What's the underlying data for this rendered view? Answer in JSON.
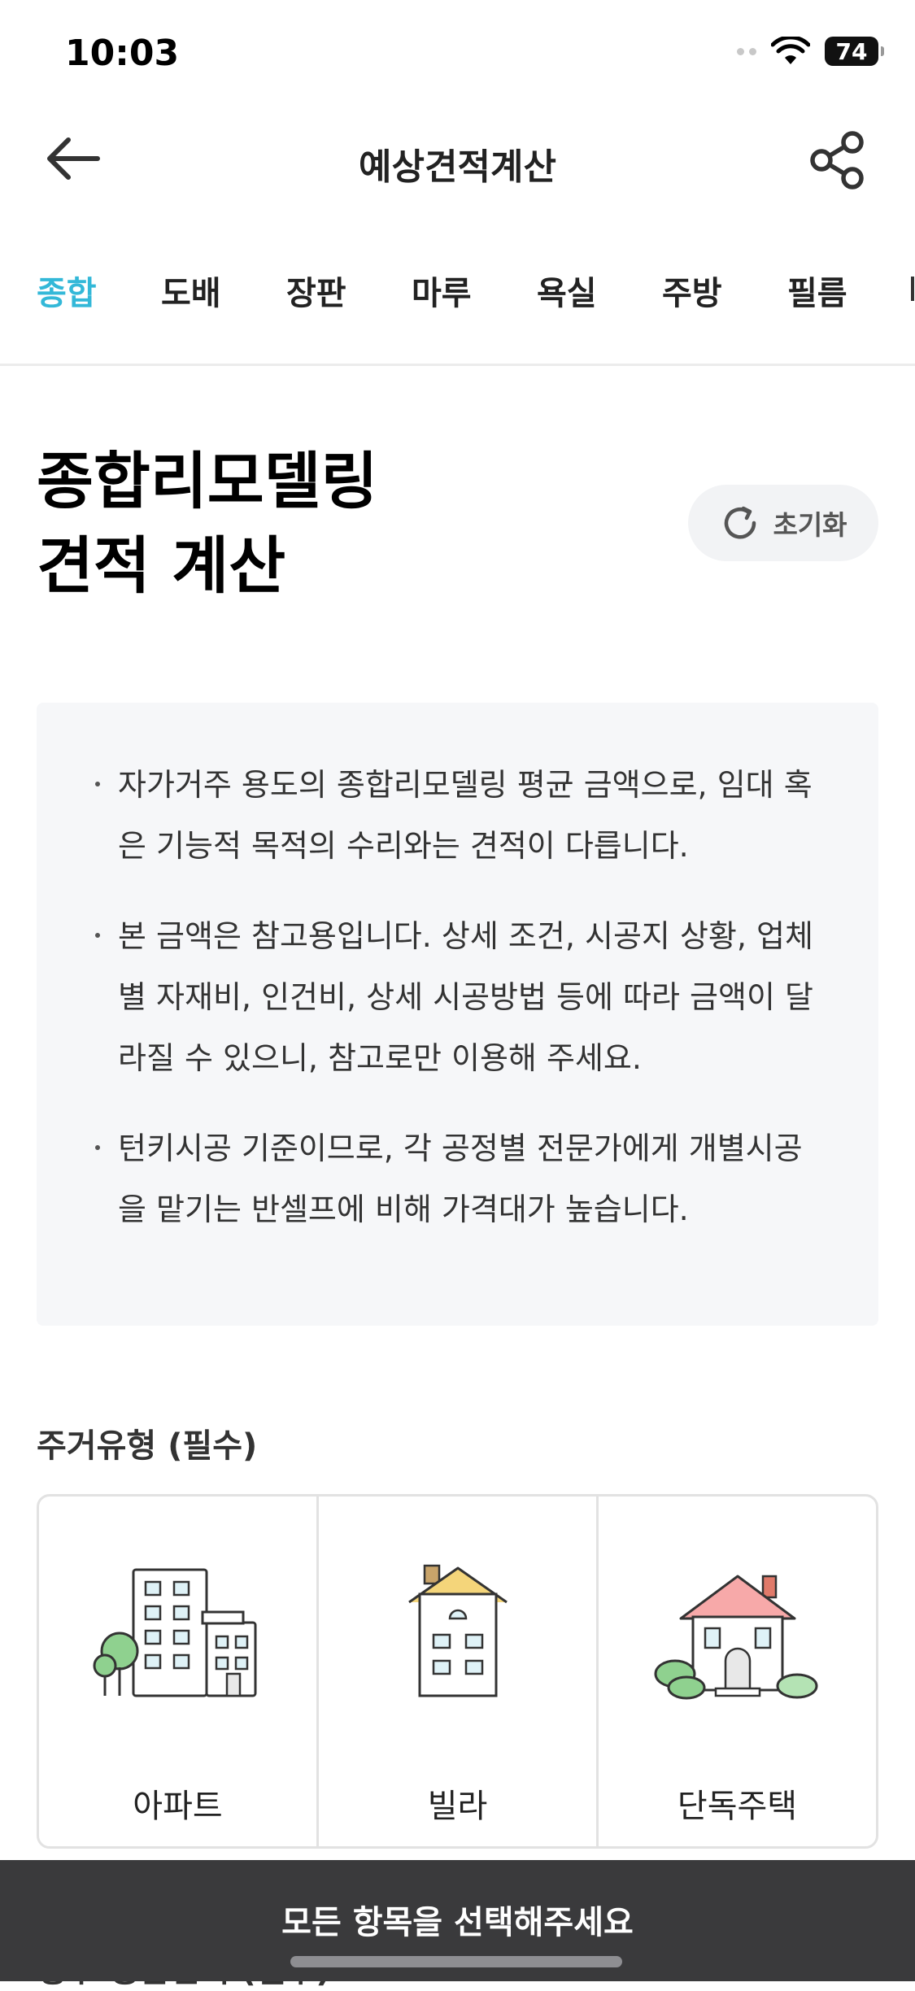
{
  "status_bar": {
    "time": "10:03",
    "battery": "74"
  },
  "nav": {
    "title": "예상견적계산"
  },
  "tabs": [
    {
      "label": "종합",
      "active": true
    },
    {
      "label": "도배",
      "active": false
    },
    {
      "label": "장판",
      "active": false
    },
    {
      "label": "마루",
      "active": false
    },
    {
      "label": "욕실",
      "active": false
    },
    {
      "label": "주방",
      "active": false
    },
    {
      "label": "필름",
      "active": false
    }
  ],
  "header": {
    "title_line1": "종합리모델링",
    "title_line2": "견적 계산",
    "reset_label": "초기화"
  },
  "notice": {
    "items": [
      "자가거주 용도의 종합리모델링 평균 금액으로, 임대 혹은 기능적 목적의 수리와는 견적이 다릅니다.",
      "본 금액은 참고용입니다. 상세 조건, 시공지 상황, 업체별 자재비, 인건비, 상세 시공방법 등에 따라 금액이 달라질 수 있으니, 참고로만 이용해 주세요.",
      "턴키시공 기준이므로, 각 공정별 전문가에게 개별시공을 맡기는 반셀프에 비해 가격대가 높습니다."
    ]
  },
  "housing_type": {
    "label": "주거유형 (필수)",
    "options": [
      {
        "label": "아파트",
        "icon": "apartment-icon"
      },
      {
        "label": "빌라",
        "icon": "villa-icon"
      },
      {
        "label": "단독주택",
        "icon": "detached-house-icon"
      }
    ]
  },
  "area": {
    "label": "평수-공급면적 (필수)"
  },
  "bottom_bar": {
    "label": "모든 항목을 선택해주세요"
  },
  "colors": {
    "accent": "#33b8d8",
    "notice_bg": "#f6f7f9",
    "bottom_bar": "#3a3a3c"
  }
}
